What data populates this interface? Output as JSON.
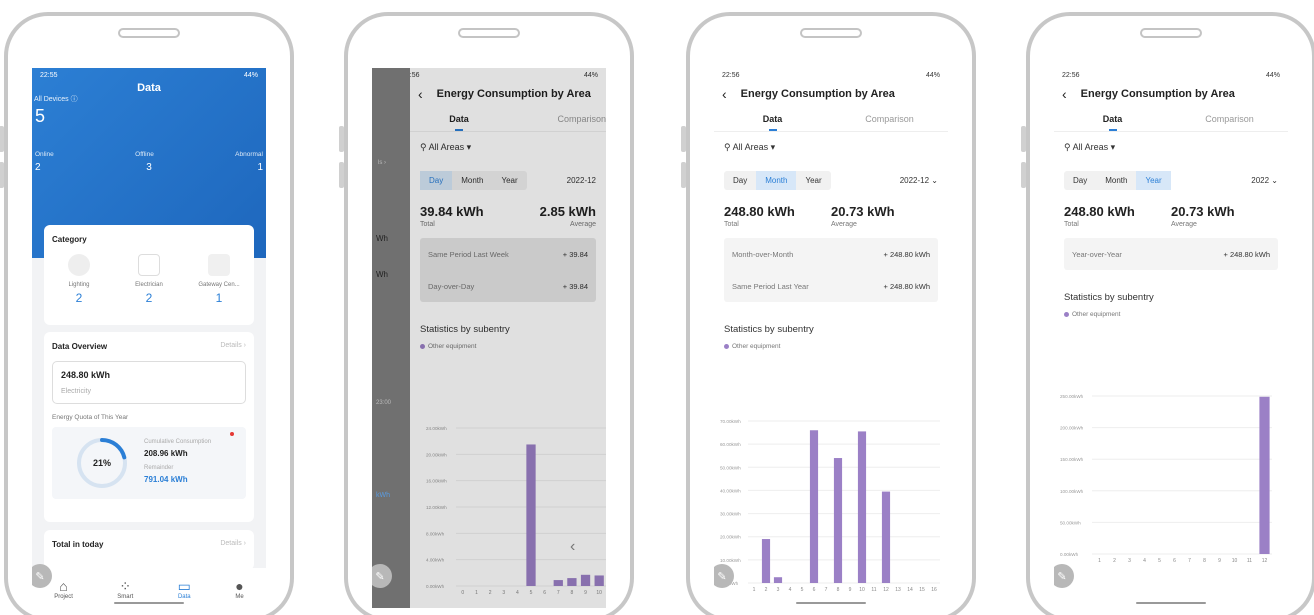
{
  "phone1": {
    "status_time": "22:55",
    "status_right": "44%",
    "title": "Data",
    "all_devices_label": "All Devices",
    "all_devices_count": "5",
    "stats": [
      {
        "label": "Online",
        "value": "2"
      },
      {
        "label": "Offline",
        "value": "3"
      },
      {
        "label": "Abnormal",
        "value": "1"
      }
    ],
    "category_title": "Category",
    "categories": [
      {
        "label": "Lighting",
        "count": "2"
      },
      {
        "label": "Electrician",
        "count": "2"
      },
      {
        "label": "Gateway Cen...",
        "count": "1"
      }
    ],
    "overview_title": "Data Overview",
    "details": "Details",
    "electricity_value": "248.80 kWh",
    "electricity_label": "Electricity",
    "quota_title": "Energy Quota of This Year",
    "quota_percent": "21%",
    "quota_fraction": 0.21,
    "cumulative_label": "Cumulative Consumption",
    "cumulative_value": "208.96 kWh",
    "remainder_label": "Remainder",
    "remainder_value": "791.04 kWh",
    "total_today": "Total in today",
    "nav": [
      "Project",
      "Smart",
      "Data",
      "Me"
    ]
  },
  "phone2": {
    "status_time": "22:56",
    "status_right": "44%",
    "title": "Energy Consumption by Area",
    "tabs": [
      "Data",
      "Comparison"
    ],
    "area": "All Areas",
    "segments": [
      "Day",
      "Month",
      "Year"
    ],
    "active_segment": "Day",
    "period": "2022-12",
    "total_value": "39.84 kWh",
    "total_label": "Total",
    "average_value": "2.85 kWh",
    "average_label": "Average",
    "comparisons": [
      {
        "label": "Same Period Last Week",
        "value": "+ 39.84"
      },
      {
        "label": "Day-over-Day",
        "value": "+ 39.84"
      }
    ],
    "stats_title": "Statistics by subentry",
    "legend": "Other equipment",
    "side_items": [
      "Wh",
      "Wh",
      "23:00",
      "kWh"
    ]
  },
  "phone3": {
    "status_time": "22:56",
    "status_right": "44%",
    "title": "Energy Consumption by Area",
    "tabs": [
      "Data",
      "Comparison"
    ],
    "area": "All Areas",
    "segments": [
      "Day",
      "Month",
      "Year"
    ],
    "active_segment": "Month",
    "period": "2022-12",
    "total_value": "248.80 kWh",
    "total_label": "Total",
    "average_value": "20.73 kWh",
    "average_label": "Average",
    "comparisons": [
      {
        "label": "Month-over-Month",
        "value": "+ 248.80 kWh"
      },
      {
        "label": "Same Period Last Year",
        "value": "+ 248.80 kWh"
      }
    ],
    "stats_title": "Statistics by subentry",
    "legend": "Other equipment"
  },
  "phone4": {
    "status_time": "22:56",
    "status_right": "44%",
    "title": "Energy Consumption by Area",
    "tabs": [
      "Data",
      "Comparison"
    ],
    "area": "All Areas",
    "segments": [
      "Day",
      "Month",
      "Year"
    ],
    "active_segment": "Year",
    "period": "2022",
    "total_value": "248.80 kWh",
    "total_label": "Total",
    "average_value": "20.73 kWh",
    "average_label": "Average",
    "comparisons": [
      {
        "label": "Year-over-Year",
        "value": "+ 248.80 kWh"
      }
    ],
    "stats_title": "Statistics by subentry",
    "legend": "Other equipment"
  },
  "colors": {
    "accent": "#2b7fd6",
    "bar": "#9b80c6"
  },
  "chart_data": [
    {
      "type": "bar",
      "categories": [
        "0",
        "1",
        "2",
        "3",
        "4",
        "5",
        "6",
        "7",
        "8",
        "9",
        "10"
      ],
      "values": [
        0,
        0,
        0,
        0,
        0,
        21.5,
        0,
        0.9,
        1.2,
        1.7,
        1.6
      ],
      "ylim": [
        0,
        24
      ],
      "yticks": [
        "0.00kWh",
        "4.00kWh",
        "8.00kWh",
        "12.00kWh",
        "16.00kWh",
        "20.00kWh",
        "24.00kWh"
      ],
      "legend": "Other equipment"
    },
    {
      "type": "bar",
      "categories": [
        "1",
        "2",
        "3",
        "4",
        "5",
        "6",
        "7",
        "8",
        "9",
        "10",
        "11",
        "12",
        "13",
        "14",
        "15",
        "16"
      ],
      "values": [
        0,
        19,
        2.5,
        0,
        0,
        66,
        0,
        54,
        0,
        65.5,
        0,
        39.5,
        0,
        0,
        0,
        0
      ],
      "ylim": [
        0,
        70
      ],
      "yticks": [
        "0.00kWh",
        "10.00kWh",
        "20.00kWh",
        "30.00kWh",
        "40.00kWh",
        "50.00kWh",
        "60.00kWh",
        "70.00kWh"
      ],
      "legend": "Other equipment"
    },
    {
      "type": "bar",
      "categories": [
        "1",
        "2",
        "3",
        "4",
        "5",
        "6",
        "7",
        "8",
        "9",
        "10",
        "11",
        "12"
      ],
      "values": [
        0,
        0,
        0,
        0,
        0,
        0,
        0,
        0,
        0,
        0,
        0,
        248.8
      ],
      "ylim": [
        0,
        250
      ],
      "yticks": [
        "0.00kWh",
        "50.00kWh",
        "100.00kWh",
        "150.00kWh",
        "200.00kWh",
        "250.00kWh"
      ],
      "legend": "Other equipment"
    }
  ]
}
